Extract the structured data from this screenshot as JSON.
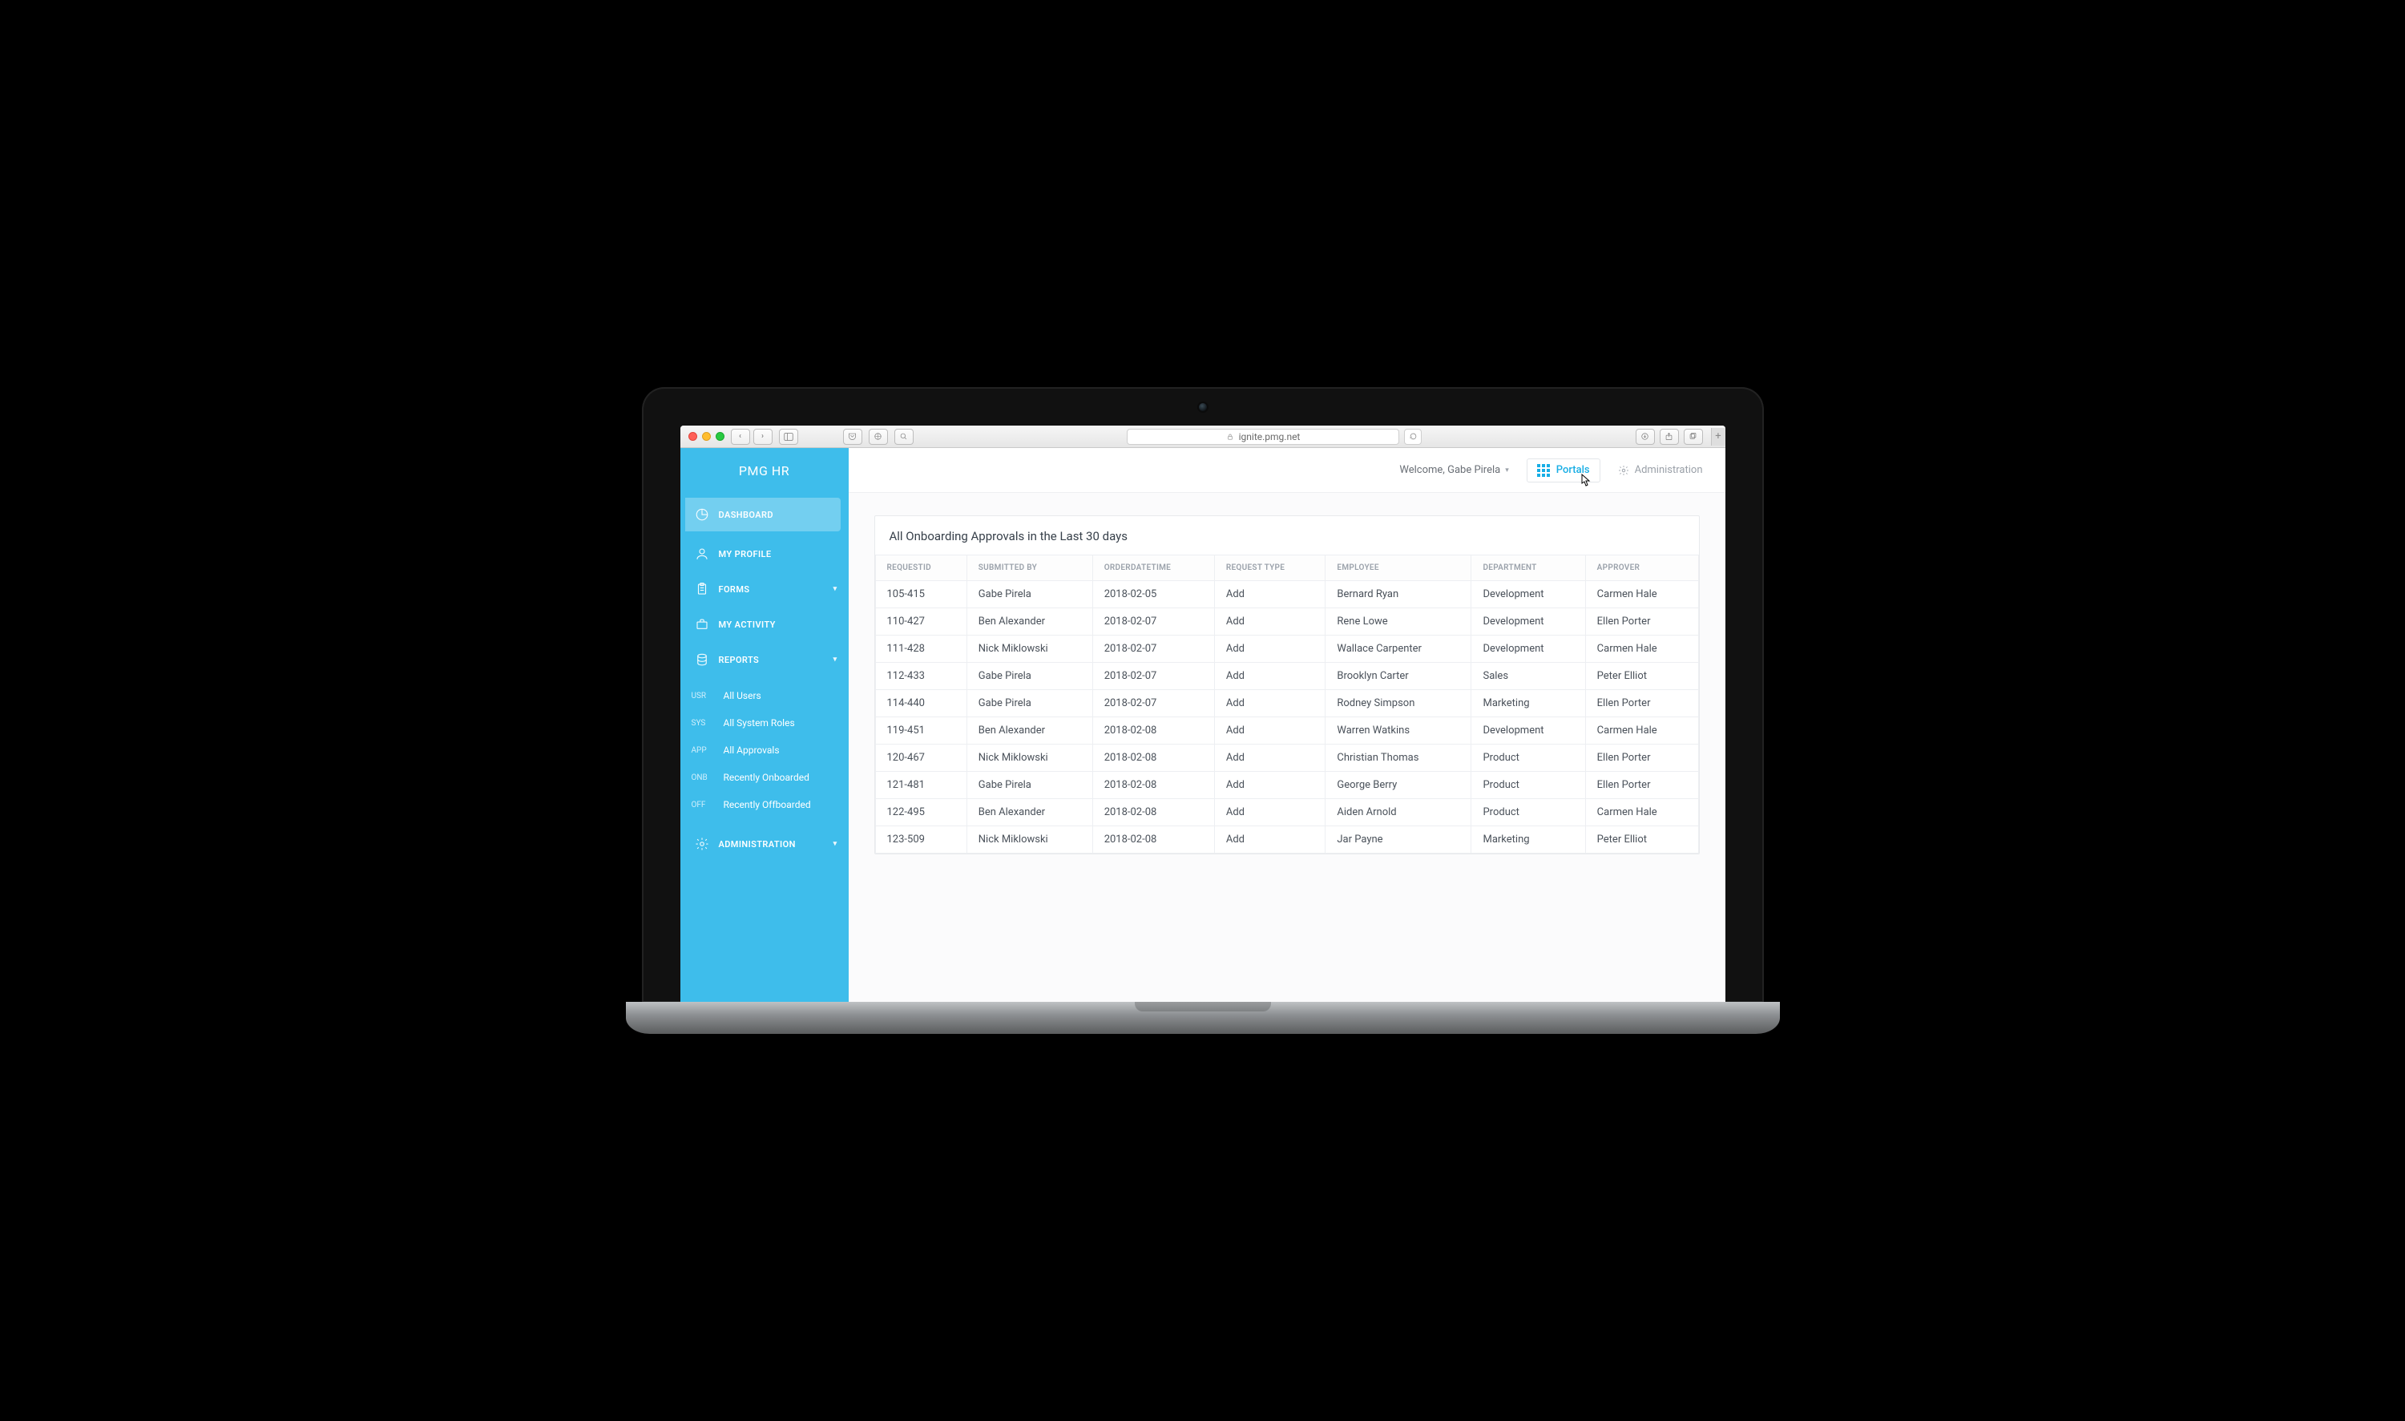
{
  "browser": {
    "url_host": "ignite.pmg.net"
  },
  "app": {
    "brand": "PMG HR",
    "topbar": {
      "welcome": "Welcome, Gabe Pirela",
      "portals": "Portals",
      "administration": "Administration"
    },
    "sidebar": {
      "items": [
        {
          "key": "dashboard",
          "label": "DASHBOARD",
          "icon": "pie"
        },
        {
          "key": "myprofile",
          "label": "MY PROFILE",
          "icon": "user"
        },
        {
          "key": "forms",
          "label": "FORMS",
          "icon": "clipboard",
          "expandable": true
        },
        {
          "key": "myactivity",
          "label": "MY ACTIVITY",
          "icon": "briefcase"
        },
        {
          "key": "reports",
          "label": "REPORTS",
          "icon": "stack",
          "expandable": true
        }
      ],
      "reports_sub": [
        {
          "code": "USR",
          "label": "All Users"
        },
        {
          "code": "SYS",
          "label": "All System Roles"
        },
        {
          "code": "APP",
          "label": "All Approvals"
        },
        {
          "code": "ONB",
          "label": "Recently Onboarded"
        },
        {
          "code": "OFF",
          "label": "Recently Offboarded"
        }
      ],
      "administration": {
        "label": "ADMINISTRATION",
        "icon": "gear",
        "expandable": true
      }
    },
    "card": {
      "title": "All Onboarding Approvals in the Last 30 days",
      "columns": [
        "REQUESTID",
        "SUBMITTED BY",
        "ORDERDATETIME",
        "REQUEST TYPE",
        "EMPLOYEE",
        "DEPARTMENT",
        "APPROVER"
      ],
      "rows": [
        [
          "105-415",
          "Gabe Pirela",
          "2018-02-05",
          "Add",
          "Bernard Ryan",
          "Development",
          "Carmen Hale"
        ],
        [
          "110-427",
          "Ben Alexander",
          "2018-02-07",
          "Add",
          "Rene Lowe",
          "Development",
          "Ellen Porter"
        ],
        [
          "111-428",
          "Nick Miklowski",
          "2018-02-07",
          "Add",
          "Wallace Carpenter",
          "Development",
          "Carmen Hale"
        ],
        [
          "112-433",
          "Gabe Pirela",
          "2018-02-07",
          "Add",
          "Brooklyn Carter",
          "Sales",
          "Peter Elliot"
        ],
        [
          "114-440",
          "Gabe Pirela",
          "2018-02-07",
          "Add",
          "Rodney Simpson",
          "Marketing",
          "Ellen Porter"
        ],
        [
          "119-451",
          "Ben Alexander",
          "2018-02-08",
          "Add",
          "Warren Watkins",
          "Development",
          "Carmen Hale"
        ],
        [
          "120-467",
          "Nick Miklowski",
          "2018-02-08",
          "Add",
          "Christian Thomas",
          "Product",
          "Ellen Porter"
        ],
        [
          "121-481",
          "Gabe Pirela",
          "2018-02-08",
          "Add",
          "George Berry",
          "Product",
          "Ellen Porter"
        ],
        [
          "122-495",
          "Ben Alexander",
          "2018-02-08",
          "Add",
          "Aiden Arnold",
          "Product",
          "Carmen Hale"
        ],
        [
          "123-509",
          "Nick Miklowski",
          "2018-02-08",
          "Add",
          "Jar Payne",
          "Marketing",
          "Peter Elliot"
        ]
      ]
    }
  }
}
